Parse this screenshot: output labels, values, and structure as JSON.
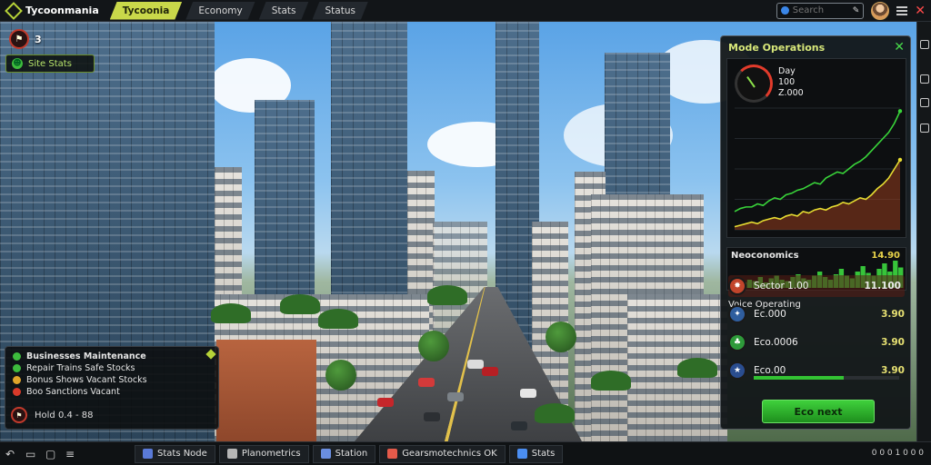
{
  "topbar": {
    "app_title": "Tycoonmania",
    "tabs": [
      {
        "label": "Tycoonia",
        "active": true
      },
      {
        "label": "Economy",
        "active": false
      },
      {
        "label": "Stats",
        "active": false
      },
      {
        "label": "Status",
        "active": false
      }
    ],
    "search_placeholder": "Search"
  },
  "hud": {
    "alert_count": "3",
    "status_label": "Site Stats"
  },
  "info_panel": {
    "title": "Businesses Maintenance",
    "rows": [
      {
        "text": "Repair  Trains  Safe Stocks",
        "color": "#3dbb3d"
      },
      {
        "text": "Bonus  Shows  Vacant Stocks",
        "color": "#e0a52a"
      },
      {
        "text": "Boo  Sanctions  Vacant",
        "color": "#d93a2a"
      }
    ],
    "footer": "Hold 0.4 - 88"
  },
  "panel": {
    "title": "Mode Operations",
    "gauge": {
      "line1": "Day",
      "line2": "100",
      "line3": "Z.000"
    },
    "chart_data": {
      "type": "line",
      "series": [
        {
          "name": "",
          "color": "#39d43a",
          "values": [
            12,
            14,
            15,
            15,
            17,
            16,
            19,
            21,
            20,
            23,
            24,
            26,
            27,
            29,
            31,
            30,
            34,
            36,
            38,
            37,
            40,
            43,
            45,
            48,
            52,
            56,
            60,
            64,
            70,
            78
          ]
        },
        {
          "name": "",
          "color": "#e6dc32",
          "values": [
            2,
            3,
            4,
            5,
            4,
            6,
            7,
            8,
            7,
            9,
            10,
            9,
            12,
            11,
            13,
            14,
            13,
            15,
            16,
            18,
            17,
            19,
            21,
            20,
            23,
            27,
            30,
            34,
            40,
            46
          ]
        }
      ],
      "ylim": [
        0,
        80
      ]
    },
    "mini_chart": {
      "title": "Neoconomics",
      "value": "14.90",
      "values": [
        3,
        5,
        4,
        6,
        5,
        8,
        4,
        7,
        9,
        6,
        5,
        8,
        10,
        7,
        6,
        9,
        12,
        8,
        6,
        10,
        14,
        9,
        7,
        12,
        16,
        11,
        9,
        14,
        18,
        12,
        20,
        15
      ]
    },
    "section_title": "Voice Operating",
    "stats": [
      {
        "label": "Sector 1.00",
        "value": "11.100",
        "icon_color": "#c2452b"
      },
      {
        "label": "Ec.000",
        "value": "3.90",
        "icon_color": "#2f5e9e"
      },
      {
        "label": "Eco.0006",
        "value": "3.90",
        "icon_color": "#2e9a3a"
      },
      {
        "label": "Eco.00",
        "value": "3.90",
        "icon_color": "#2a4d8f"
      }
    ],
    "progress": 0.62,
    "action_label": "Eco next"
  },
  "taskbar": {
    "items": [
      {
        "label": "Stats Node",
        "color": "#5a7ad8"
      },
      {
        "label": "Planometrics",
        "color": "#b6b6b6"
      },
      {
        "label": "Station",
        "color": "#6a8ee0"
      },
      {
        "label": "Gearsmotechnics OK",
        "color": "#e45a4a"
      },
      {
        "label": "Stats",
        "color": "#4b8ef2"
      }
    ],
    "tray": "0 0 0 1 0 0 0"
  }
}
